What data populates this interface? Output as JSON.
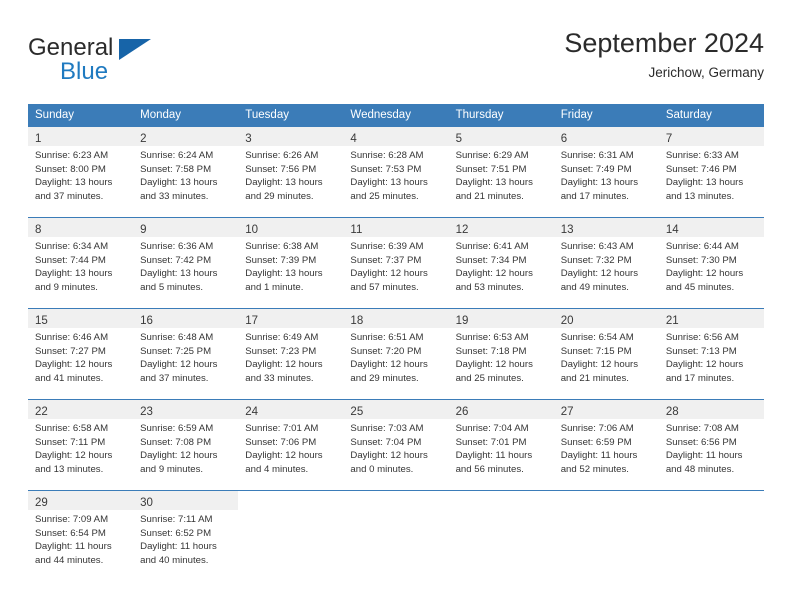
{
  "brand": {
    "name_part1": "General",
    "name_part2": "Blue",
    "flag_icon": "blue-flag-icon",
    "accent_color": "#1f7ac0"
  },
  "header": {
    "month_title": "September 2024",
    "location": "Jerichow, Germany",
    "header_bg_color": "#3b7cb8",
    "daynum_band_color": "#f0f0f0"
  },
  "day_headers": [
    "Sunday",
    "Monday",
    "Tuesday",
    "Wednesday",
    "Thursday",
    "Friday",
    "Saturday"
  ],
  "labels": {
    "sunrise_prefix": "Sunrise:",
    "sunset_prefix": "Sunset:",
    "daylight_prefix": "Daylight:"
  },
  "weeks": [
    [
      {
        "day": "1",
        "sunrise": "Sunrise: 6:23 AM",
        "sunset": "Sunset: 8:00 PM",
        "daylight_line1": "Daylight: 13 hours",
        "daylight_line2": "and 37 minutes."
      },
      {
        "day": "2",
        "sunrise": "Sunrise: 6:24 AM",
        "sunset": "Sunset: 7:58 PM",
        "daylight_line1": "Daylight: 13 hours",
        "daylight_line2": "and 33 minutes."
      },
      {
        "day": "3",
        "sunrise": "Sunrise: 6:26 AM",
        "sunset": "Sunset: 7:56 PM",
        "daylight_line1": "Daylight: 13 hours",
        "daylight_line2": "and 29 minutes."
      },
      {
        "day": "4",
        "sunrise": "Sunrise: 6:28 AM",
        "sunset": "Sunset: 7:53 PM",
        "daylight_line1": "Daylight: 13 hours",
        "daylight_line2": "and 25 minutes."
      },
      {
        "day": "5",
        "sunrise": "Sunrise: 6:29 AM",
        "sunset": "Sunset: 7:51 PM",
        "daylight_line1": "Daylight: 13 hours",
        "daylight_line2": "and 21 minutes."
      },
      {
        "day": "6",
        "sunrise": "Sunrise: 6:31 AM",
        "sunset": "Sunset: 7:49 PM",
        "daylight_line1": "Daylight: 13 hours",
        "daylight_line2": "and 17 minutes."
      },
      {
        "day": "7",
        "sunrise": "Sunrise: 6:33 AM",
        "sunset": "Sunset: 7:46 PM",
        "daylight_line1": "Daylight: 13 hours",
        "daylight_line2": "and 13 minutes."
      }
    ],
    [
      {
        "day": "8",
        "sunrise": "Sunrise: 6:34 AM",
        "sunset": "Sunset: 7:44 PM",
        "daylight_line1": "Daylight: 13 hours",
        "daylight_line2": "and 9 minutes."
      },
      {
        "day": "9",
        "sunrise": "Sunrise: 6:36 AM",
        "sunset": "Sunset: 7:42 PM",
        "daylight_line1": "Daylight: 13 hours",
        "daylight_line2": "and 5 minutes."
      },
      {
        "day": "10",
        "sunrise": "Sunrise: 6:38 AM",
        "sunset": "Sunset: 7:39 PM",
        "daylight_line1": "Daylight: 13 hours",
        "daylight_line2": "and 1 minute."
      },
      {
        "day": "11",
        "sunrise": "Sunrise: 6:39 AM",
        "sunset": "Sunset: 7:37 PM",
        "daylight_line1": "Daylight: 12 hours",
        "daylight_line2": "and 57 minutes."
      },
      {
        "day": "12",
        "sunrise": "Sunrise: 6:41 AM",
        "sunset": "Sunset: 7:34 PM",
        "daylight_line1": "Daylight: 12 hours",
        "daylight_line2": "and 53 minutes."
      },
      {
        "day": "13",
        "sunrise": "Sunrise: 6:43 AM",
        "sunset": "Sunset: 7:32 PM",
        "daylight_line1": "Daylight: 12 hours",
        "daylight_line2": "and 49 minutes."
      },
      {
        "day": "14",
        "sunrise": "Sunrise: 6:44 AM",
        "sunset": "Sunset: 7:30 PM",
        "daylight_line1": "Daylight: 12 hours",
        "daylight_line2": "and 45 minutes."
      }
    ],
    [
      {
        "day": "15",
        "sunrise": "Sunrise: 6:46 AM",
        "sunset": "Sunset: 7:27 PM",
        "daylight_line1": "Daylight: 12 hours",
        "daylight_line2": "and 41 minutes."
      },
      {
        "day": "16",
        "sunrise": "Sunrise: 6:48 AM",
        "sunset": "Sunset: 7:25 PM",
        "daylight_line1": "Daylight: 12 hours",
        "daylight_line2": "and 37 minutes."
      },
      {
        "day": "17",
        "sunrise": "Sunrise: 6:49 AM",
        "sunset": "Sunset: 7:23 PM",
        "daylight_line1": "Daylight: 12 hours",
        "daylight_line2": "and 33 minutes."
      },
      {
        "day": "18",
        "sunrise": "Sunrise: 6:51 AM",
        "sunset": "Sunset: 7:20 PM",
        "daylight_line1": "Daylight: 12 hours",
        "daylight_line2": "and 29 minutes."
      },
      {
        "day": "19",
        "sunrise": "Sunrise: 6:53 AM",
        "sunset": "Sunset: 7:18 PM",
        "daylight_line1": "Daylight: 12 hours",
        "daylight_line2": "and 25 minutes."
      },
      {
        "day": "20",
        "sunrise": "Sunrise: 6:54 AM",
        "sunset": "Sunset: 7:15 PM",
        "daylight_line1": "Daylight: 12 hours",
        "daylight_line2": "and 21 minutes."
      },
      {
        "day": "21",
        "sunrise": "Sunrise: 6:56 AM",
        "sunset": "Sunset: 7:13 PM",
        "daylight_line1": "Daylight: 12 hours",
        "daylight_line2": "and 17 minutes."
      }
    ],
    [
      {
        "day": "22",
        "sunrise": "Sunrise: 6:58 AM",
        "sunset": "Sunset: 7:11 PM",
        "daylight_line1": "Daylight: 12 hours",
        "daylight_line2": "and 13 minutes."
      },
      {
        "day": "23",
        "sunrise": "Sunrise: 6:59 AM",
        "sunset": "Sunset: 7:08 PM",
        "daylight_line1": "Daylight: 12 hours",
        "daylight_line2": "and 9 minutes."
      },
      {
        "day": "24",
        "sunrise": "Sunrise: 7:01 AM",
        "sunset": "Sunset: 7:06 PM",
        "daylight_line1": "Daylight: 12 hours",
        "daylight_line2": "and 4 minutes."
      },
      {
        "day": "25",
        "sunrise": "Sunrise: 7:03 AM",
        "sunset": "Sunset: 7:04 PM",
        "daylight_line1": "Daylight: 12 hours",
        "daylight_line2": "and 0 minutes."
      },
      {
        "day": "26",
        "sunrise": "Sunrise: 7:04 AM",
        "sunset": "Sunset: 7:01 PM",
        "daylight_line1": "Daylight: 11 hours",
        "daylight_line2": "and 56 minutes."
      },
      {
        "day": "27",
        "sunrise": "Sunrise: 7:06 AM",
        "sunset": "Sunset: 6:59 PM",
        "daylight_line1": "Daylight: 11 hours",
        "daylight_line2": "and 52 minutes."
      },
      {
        "day": "28",
        "sunrise": "Sunrise: 7:08 AM",
        "sunset": "Sunset: 6:56 PM",
        "daylight_line1": "Daylight: 11 hours",
        "daylight_line2": "and 48 minutes."
      }
    ],
    [
      {
        "day": "29",
        "sunrise": "Sunrise: 7:09 AM",
        "sunset": "Sunset: 6:54 PM",
        "daylight_line1": "Daylight: 11 hours",
        "daylight_line2": "and 44 minutes."
      },
      {
        "day": "30",
        "sunrise": "Sunrise: 7:11 AM",
        "sunset": "Sunset: 6:52 PM",
        "daylight_line1": "Daylight: 11 hours",
        "daylight_line2": "and 40 minutes."
      },
      {
        "day": "",
        "sunrise": "",
        "sunset": "",
        "daylight_line1": "",
        "daylight_line2": ""
      },
      {
        "day": "",
        "sunrise": "",
        "sunset": "",
        "daylight_line1": "",
        "daylight_line2": ""
      },
      {
        "day": "",
        "sunrise": "",
        "sunset": "",
        "daylight_line1": "",
        "daylight_line2": ""
      },
      {
        "day": "",
        "sunrise": "",
        "sunset": "",
        "daylight_line1": "",
        "daylight_line2": ""
      },
      {
        "day": "",
        "sunrise": "",
        "sunset": "",
        "daylight_line1": "",
        "daylight_line2": ""
      }
    ]
  ]
}
